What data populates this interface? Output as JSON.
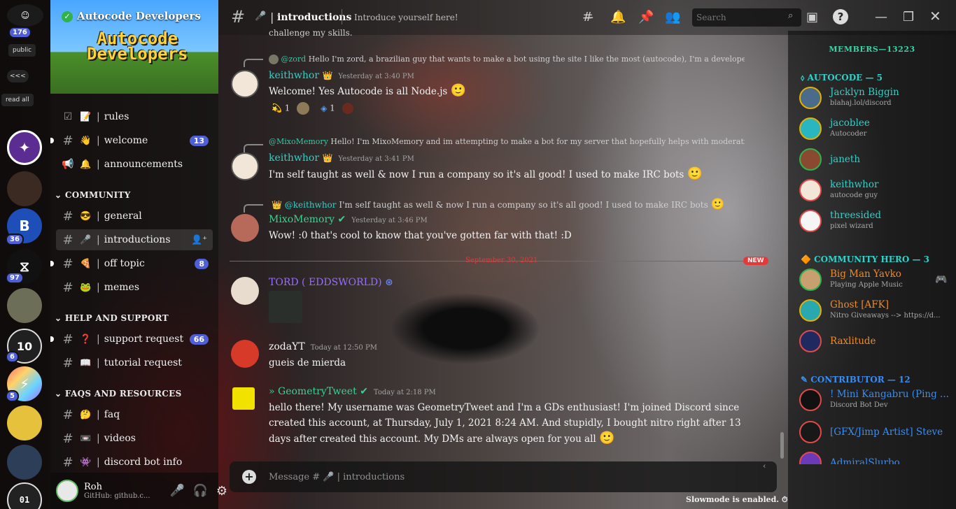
{
  "rail": {
    "unread_count": "176",
    "public_label": "public",
    "collapse_label": "<<<",
    "read_all_label": "read all",
    "servers": [
      {
        "name": "Autocode Developers",
        "letter": "✦",
        "color": "#5b2c91",
        "badge": ""
      },
      {
        "name": "server-2",
        "letter": "",
        "color": "#3a2a22",
        "badge": ""
      },
      {
        "name": "server-3",
        "letter": "B",
        "color": "#1e4fb8",
        "badge": "36"
      },
      {
        "name": "server-4",
        "letter": "⧖",
        "color": "#111111",
        "badge": "97"
      },
      {
        "name": "server-5",
        "letter": "",
        "color": "#6d6e58",
        "badge": ""
      },
      {
        "name": "server-6",
        "letter": "10",
        "color": "#202020",
        "badge": "6"
      },
      {
        "name": "server-7",
        "letter": "⚡",
        "color": "#6a7cff",
        "badge": "5"
      },
      {
        "name": "server-8",
        "letter": "",
        "color": "#e6c23c",
        "badge": ""
      },
      {
        "name": "server-9",
        "letter": "",
        "color": "#2c3e58",
        "badge": ""
      },
      {
        "name": "server-10",
        "letter": "01",
        "color": "#222222",
        "badge": ""
      }
    ]
  },
  "server": {
    "name": "Autocode Developers",
    "banner_logo_line1": "Autocode",
    "banner_logo_line2": "Developers"
  },
  "channels": {
    "rules": {
      "label": "rules",
      "emoji": "📝"
    },
    "welcome": {
      "label": "welcome",
      "emoji": "👋",
      "badge": "13"
    },
    "announcements": {
      "label": "announcements",
      "emoji": "🔔"
    },
    "cat_community": "COMMUNITY",
    "general": {
      "label": "general",
      "emoji": "😎"
    },
    "introductions": {
      "label": "introductions",
      "emoji": "🎤"
    },
    "off_topic": {
      "label": "off topic",
      "emoji": "🍕",
      "badge": "8"
    },
    "memes": {
      "label": "memes",
      "emoji": "🐸"
    },
    "cat_help": "HELP AND SUPPORT",
    "support_request": {
      "label": "support request",
      "emoji": "❓",
      "badge": "66"
    },
    "tutorial_request": {
      "label": "tutorial request",
      "emoji": "📖"
    },
    "cat_faqs": "FAQS AND RESOURCES",
    "faq": {
      "label": "faq",
      "emoji": "🤔"
    },
    "videos": {
      "label": "videos",
      "emoji": "📼"
    },
    "discord_bot_info": {
      "label": "discord bot info",
      "emoji": "👾"
    }
  },
  "user": {
    "name": "Roh",
    "status": "GitHub: github.c..."
  },
  "header": {
    "channel": "introductions",
    "topic": "Introduce yourself here!",
    "search_placeholder": "Search"
  },
  "messages": {
    "top_cut": "challenge my skills.",
    "m1_reply_user": "@zord",
    "m1_reply_text": "Hello I'm zord, a brazilian guy that wants to make a bot using the site I like the most (autocode), I'm a developer of a p...",
    "m1_user": "keithwhor",
    "m1_time": "Yesterday at 3:40 PM",
    "m1_text": "Welcome! Yes Autocode is all Node.js",
    "m1_react1": "1",
    "m1_react2": "1",
    "m2_reply_user": "@MixoMemory",
    "m2_reply_text": "Hello! I'm MixoMemory and im attempting to make a bot for my server that hopefully helps with moderatio...",
    "m2_user": "keithwhor",
    "m2_time": "Yesterday at 3:41 PM",
    "m2_text": "I'm self taught as well & now I run a company so it's all good! I used to make IRC bots",
    "m3_reply_user": "@keithwhor",
    "m3_reply_text": "I'm self taught as well & now I run a company so it's all good! I used to make IRC bots",
    "m3_user": "MixoMemory",
    "m3_time": "Yesterday at 3:46 PM",
    "m3_text": "Wow! :0 that's cool to know that you've gotten far with that! :D",
    "divider_date": "September 30, 2021",
    "divider_tag": "NEW",
    "m4_user": "TORD ( EDDSWORLD)",
    "m5_user": "zodaYT",
    "m5_time": "Today at 12:50 PM",
    "m5_text": "gueis de mierda",
    "m6_user": "» GeometryTweet",
    "m6_time": "Today at 2:18 PM",
    "m6_text": "hello there! My username was GeometryTweet and I'm a GDs enthusiast! I'm joined Discord since created this account, at  Thursday, July 1, 2021 8:24 AM. And stupidly, I bought nitro right after 13 days after created this account. My DMs are always open for you all"
  },
  "composer": {
    "placeholder_prefix": "Message #",
    "placeholder_channel": "introductions",
    "slowmode": "Slowmode is enabled."
  },
  "members": {
    "header": "MEMBERS—13223",
    "role_autocode": "AUTOCODE — 5",
    "role_hero": "COMMUNITY HERO — 3",
    "role_contributor": "CONTRIBUTOR — 12",
    "list": [
      {
        "name": "Jacklyn Biggin",
        "sub": "blahaj.lol/discord",
        "color": "#2fd1c8"
      },
      {
        "name": "jacoblee",
        "sub": "Autocoder",
        "color": "#2fd1c8"
      },
      {
        "name": "janeth",
        "sub": "",
        "color": "#2fd1c8"
      },
      {
        "name": "keithwhor",
        "sub": "autocode guy",
        "color": "#2fd1c8"
      },
      {
        "name": "threesided",
        "sub": "pixel wizard",
        "color": "#2fd1c8"
      },
      {
        "name": "Big Man Yavko",
        "sub": "Playing Apple Music",
        "color": "#f08a24"
      },
      {
        "name": "Ghost [AFK]",
        "sub": "Nitro Giveaways --> https://d...",
        "color": "#f08a24"
      },
      {
        "name": "Raxlitude",
        "sub": "",
        "color": "#f08a24"
      },
      {
        "name": "! Mini Kangabru (Ping ...",
        "sub": "Discord Bot Dev",
        "color": "#3a8df0"
      },
      {
        "name": "[GFX/Jimp Artist] Steve",
        "sub": "",
        "color": "#3a8df0"
      },
      {
        "name": "AdmiralSlurbo",
        "sub": "",
        "color": "#3a8df0"
      }
    ]
  }
}
